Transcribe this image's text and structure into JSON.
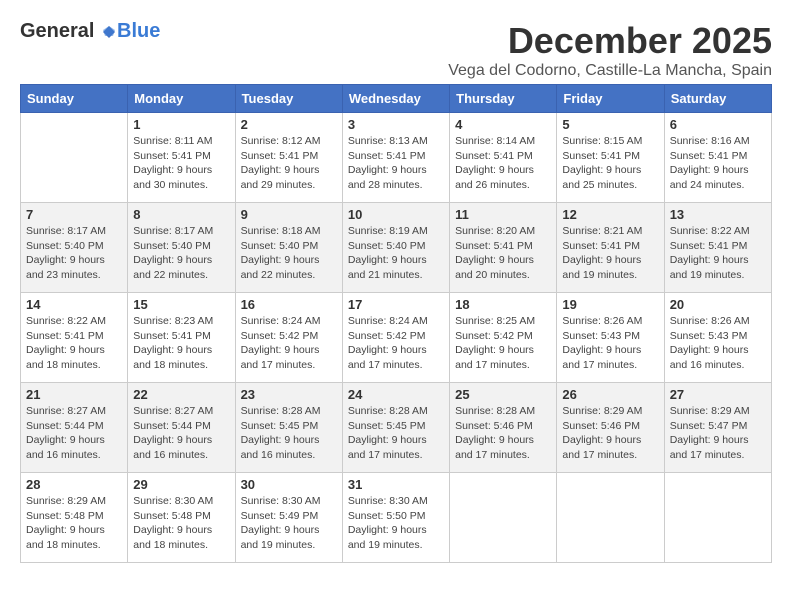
{
  "header": {
    "logo": {
      "general": "General",
      "blue": "Blue"
    },
    "title": "December 2025",
    "location": "Vega del Codorno, Castille-La Mancha, Spain"
  },
  "weekdays": [
    "Sunday",
    "Monday",
    "Tuesday",
    "Wednesday",
    "Thursday",
    "Friday",
    "Saturday"
  ],
  "weeks": [
    [
      {
        "day": "",
        "sunrise": "",
        "sunset": "",
        "daylight": ""
      },
      {
        "day": "1",
        "sunrise": "Sunrise: 8:11 AM",
        "sunset": "Sunset: 5:41 PM",
        "daylight": "Daylight: 9 hours and 30 minutes."
      },
      {
        "day": "2",
        "sunrise": "Sunrise: 8:12 AM",
        "sunset": "Sunset: 5:41 PM",
        "daylight": "Daylight: 9 hours and 29 minutes."
      },
      {
        "day": "3",
        "sunrise": "Sunrise: 8:13 AM",
        "sunset": "Sunset: 5:41 PM",
        "daylight": "Daylight: 9 hours and 28 minutes."
      },
      {
        "day": "4",
        "sunrise": "Sunrise: 8:14 AM",
        "sunset": "Sunset: 5:41 PM",
        "daylight": "Daylight: 9 hours and 26 minutes."
      },
      {
        "day": "5",
        "sunrise": "Sunrise: 8:15 AM",
        "sunset": "Sunset: 5:41 PM",
        "daylight": "Daylight: 9 hours and 25 minutes."
      },
      {
        "day": "6",
        "sunrise": "Sunrise: 8:16 AM",
        "sunset": "Sunset: 5:41 PM",
        "daylight": "Daylight: 9 hours and 24 minutes."
      }
    ],
    [
      {
        "day": "7",
        "sunrise": "Sunrise: 8:17 AM",
        "sunset": "Sunset: 5:40 PM",
        "daylight": "Daylight: 9 hours and 23 minutes."
      },
      {
        "day": "8",
        "sunrise": "Sunrise: 8:17 AM",
        "sunset": "Sunset: 5:40 PM",
        "daylight": "Daylight: 9 hours and 22 minutes."
      },
      {
        "day": "9",
        "sunrise": "Sunrise: 8:18 AM",
        "sunset": "Sunset: 5:40 PM",
        "daylight": "Daylight: 9 hours and 22 minutes."
      },
      {
        "day": "10",
        "sunrise": "Sunrise: 8:19 AM",
        "sunset": "Sunset: 5:40 PM",
        "daylight": "Daylight: 9 hours and 21 minutes."
      },
      {
        "day": "11",
        "sunrise": "Sunrise: 8:20 AM",
        "sunset": "Sunset: 5:41 PM",
        "daylight": "Daylight: 9 hours and 20 minutes."
      },
      {
        "day": "12",
        "sunrise": "Sunrise: 8:21 AM",
        "sunset": "Sunset: 5:41 PM",
        "daylight": "Daylight: 9 hours and 19 minutes."
      },
      {
        "day": "13",
        "sunrise": "Sunrise: 8:22 AM",
        "sunset": "Sunset: 5:41 PM",
        "daylight": "Daylight: 9 hours and 19 minutes."
      }
    ],
    [
      {
        "day": "14",
        "sunrise": "Sunrise: 8:22 AM",
        "sunset": "Sunset: 5:41 PM",
        "daylight": "Daylight: 9 hours and 18 minutes."
      },
      {
        "day": "15",
        "sunrise": "Sunrise: 8:23 AM",
        "sunset": "Sunset: 5:41 PM",
        "daylight": "Daylight: 9 hours and 18 minutes."
      },
      {
        "day": "16",
        "sunrise": "Sunrise: 8:24 AM",
        "sunset": "Sunset: 5:42 PM",
        "daylight": "Daylight: 9 hours and 17 minutes."
      },
      {
        "day": "17",
        "sunrise": "Sunrise: 8:24 AM",
        "sunset": "Sunset: 5:42 PM",
        "daylight": "Daylight: 9 hours and 17 minutes."
      },
      {
        "day": "18",
        "sunrise": "Sunrise: 8:25 AM",
        "sunset": "Sunset: 5:42 PM",
        "daylight": "Daylight: 9 hours and 17 minutes."
      },
      {
        "day": "19",
        "sunrise": "Sunrise: 8:26 AM",
        "sunset": "Sunset: 5:43 PM",
        "daylight": "Daylight: 9 hours and 17 minutes."
      },
      {
        "day": "20",
        "sunrise": "Sunrise: 8:26 AM",
        "sunset": "Sunset: 5:43 PM",
        "daylight": "Daylight: 9 hours and 16 minutes."
      }
    ],
    [
      {
        "day": "21",
        "sunrise": "Sunrise: 8:27 AM",
        "sunset": "Sunset: 5:44 PM",
        "daylight": "Daylight: 9 hours and 16 minutes."
      },
      {
        "day": "22",
        "sunrise": "Sunrise: 8:27 AM",
        "sunset": "Sunset: 5:44 PM",
        "daylight": "Daylight: 9 hours and 16 minutes."
      },
      {
        "day": "23",
        "sunrise": "Sunrise: 8:28 AM",
        "sunset": "Sunset: 5:45 PM",
        "daylight": "Daylight: 9 hours and 16 minutes."
      },
      {
        "day": "24",
        "sunrise": "Sunrise: 8:28 AM",
        "sunset": "Sunset: 5:45 PM",
        "daylight": "Daylight: 9 hours and 17 minutes."
      },
      {
        "day": "25",
        "sunrise": "Sunrise: 8:28 AM",
        "sunset": "Sunset: 5:46 PM",
        "daylight": "Daylight: 9 hours and 17 minutes."
      },
      {
        "day": "26",
        "sunrise": "Sunrise: 8:29 AM",
        "sunset": "Sunset: 5:46 PM",
        "daylight": "Daylight: 9 hours and 17 minutes."
      },
      {
        "day": "27",
        "sunrise": "Sunrise: 8:29 AM",
        "sunset": "Sunset: 5:47 PM",
        "daylight": "Daylight: 9 hours and 17 minutes."
      }
    ],
    [
      {
        "day": "28",
        "sunrise": "Sunrise: 8:29 AM",
        "sunset": "Sunset: 5:48 PM",
        "daylight": "Daylight: 9 hours and 18 minutes."
      },
      {
        "day": "29",
        "sunrise": "Sunrise: 8:30 AM",
        "sunset": "Sunset: 5:48 PM",
        "daylight": "Daylight: 9 hours and 18 minutes."
      },
      {
        "day": "30",
        "sunrise": "Sunrise: 8:30 AM",
        "sunset": "Sunset: 5:49 PM",
        "daylight": "Daylight: 9 hours and 19 minutes."
      },
      {
        "day": "31",
        "sunrise": "Sunrise: 8:30 AM",
        "sunset": "Sunset: 5:50 PM",
        "daylight": "Daylight: 9 hours and 19 minutes."
      },
      {
        "day": "",
        "sunrise": "",
        "sunset": "",
        "daylight": ""
      },
      {
        "day": "",
        "sunrise": "",
        "sunset": "",
        "daylight": ""
      },
      {
        "day": "",
        "sunrise": "",
        "sunset": "",
        "daylight": ""
      }
    ]
  ]
}
